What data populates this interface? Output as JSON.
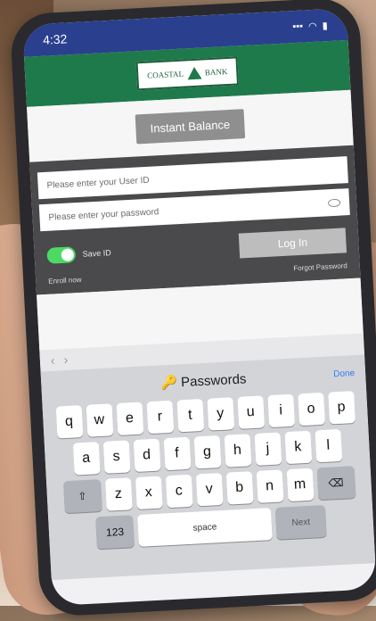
{
  "status_bar": {
    "time": "4:32",
    "signal": "▪▪▪",
    "wifi": "◠",
    "battery": "▮"
  },
  "header": {
    "logo_text_left": "COASTAL",
    "logo_text_right": "BANK"
  },
  "main": {
    "instant_balance": "Instant Balance"
  },
  "login": {
    "user_id_placeholder": "Please enter your User ID",
    "password_placeholder": "Please enter your password",
    "save_id": "Save ID",
    "login_button": "Log In",
    "enroll": "Enroll now",
    "forgot": "Forgot Password"
  },
  "accessory": {
    "prev": "‹",
    "next": "›"
  },
  "keyboard": {
    "passwords": "Passwords",
    "done": "Done",
    "row1": [
      "q",
      "w",
      "e",
      "r",
      "t",
      "y",
      "u",
      "i",
      "o",
      "p"
    ],
    "row2": [
      "a",
      "s",
      "d",
      "f",
      "g",
      "h",
      "j",
      "k",
      "l"
    ],
    "row3": [
      "z",
      "x",
      "c",
      "v",
      "b",
      "n",
      "m"
    ],
    "shift": "⇧",
    "delete": "⌫",
    "numbers": "123",
    "space": "space",
    "go": "Next"
  },
  "colors": {
    "status_bar": "#2b3f8f",
    "header": "#1f7a4b",
    "panel": "#4a4a4d",
    "toggle_on": "#4cd964"
  }
}
